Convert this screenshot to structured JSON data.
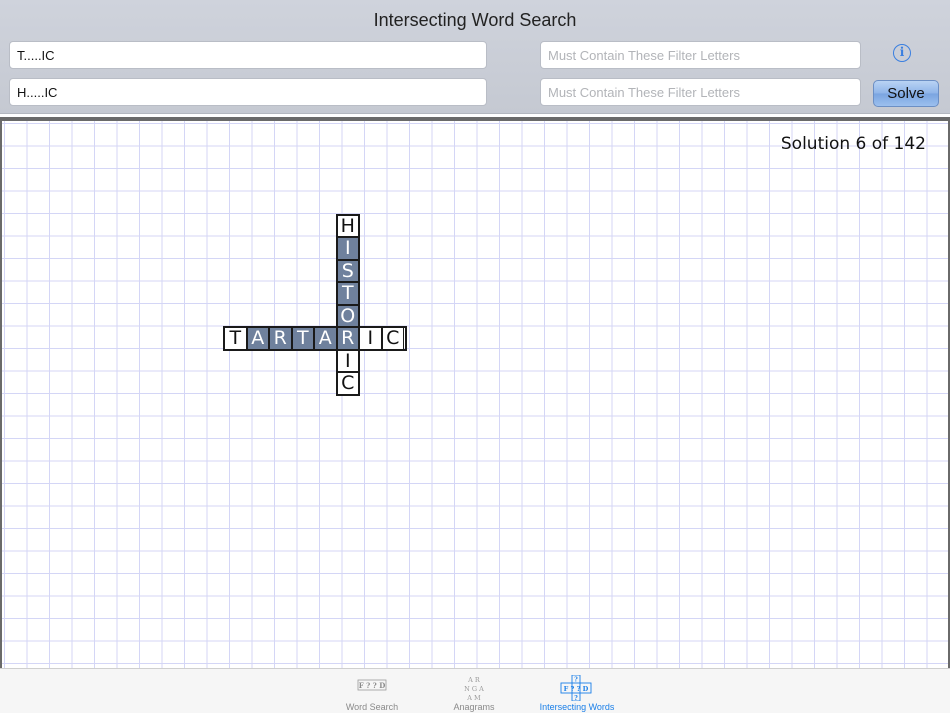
{
  "header": {
    "title": "Intersecting Word Search",
    "pattern1_value": "T.....IC",
    "pattern2_value": "H.....IC",
    "filter1_placeholder": "Must Contain These Filter Letters",
    "filter2_placeholder": "Must Contain These Filter Letters",
    "info_label": "i",
    "solve_label": "Solve"
  },
  "board": {
    "solution_text": "Solution 6 of 142",
    "horizontal_word": "TARTARIC",
    "vertical_word": "HISTORIC",
    "h_letters": [
      "T",
      "A",
      "R",
      "T",
      "A",
      "R",
      "I",
      "C"
    ],
    "v_letters": [
      "H",
      "I",
      "S",
      "T",
      "O",
      "R",
      "I",
      "C"
    ]
  },
  "tabbar": {
    "tabs": [
      {
        "label": "Word Search",
        "icon": "word-search-icon",
        "active": false
      },
      {
        "label": "Anagrams",
        "icon": "anagrams-icon",
        "active": false
      },
      {
        "label": "Intersecting Words",
        "icon": "intersecting-words-icon",
        "active": true
      }
    ],
    "active_color": "#1a7fe8"
  },
  "colors": {
    "filled_tile": "#6f819d",
    "grid_line": "#d4d6f6"
  }
}
